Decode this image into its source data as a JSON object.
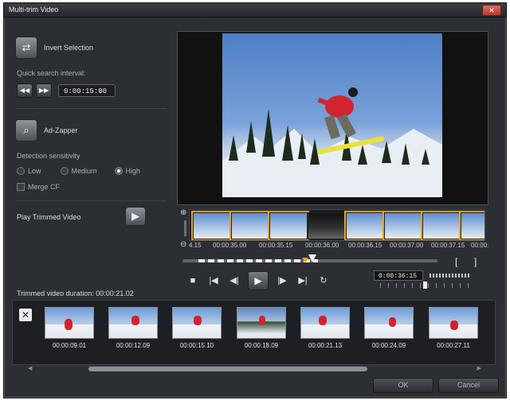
{
  "window": {
    "title": "Multi-trim Video",
    "close_glyph": "✕"
  },
  "left": {
    "invert_selection": "Invert Selection",
    "quick_search_interval": "Quick search interval:",
    "interval_value": "0:00:15:00",
    "ad_zapper": "Ad-Zapper",
    "detection_sensitivity": "Detection sensitivity",
    "sensitivity": {
      "low": "Low",
      "medium": "Medium",
      "high": "High",
      "selected": "High"
    },
    "merge_cf": "Merge CF",
    "play_trimmed_video": "Play Trimmed Video"
  },
  "filmstrip_times": [
    "4.15",
    "00:00:35.00",
    "00:00:35.15",
    "00:00:36.00",
    "00:00:36.15",
    "00:00:37.00",
    "00:00:37.15",
    "00:00:"
  ],
  "player": {
    "timecode": "0:00:36:15",
    "bracket_in": "[",
    "bracket_out": "]"
  },
  "trimmed_duration": "Trimmed video duration: 00:00:21.02",
  "clips": [
    "00:00:09.01",
    "00:00:12.09",
    "00:00:15.10",
    "00:00:18.09",
    "00:00:21.13",
    "00:00:24.09",
    "00:00:27.11"
  ],
  "buttons": {
    "ok": "OK",
    "cancel": "Cancel"
  },
  "colors": {
    "accent": "#f0a020",
    "window_bg": "#2b2e33"
  }
}
